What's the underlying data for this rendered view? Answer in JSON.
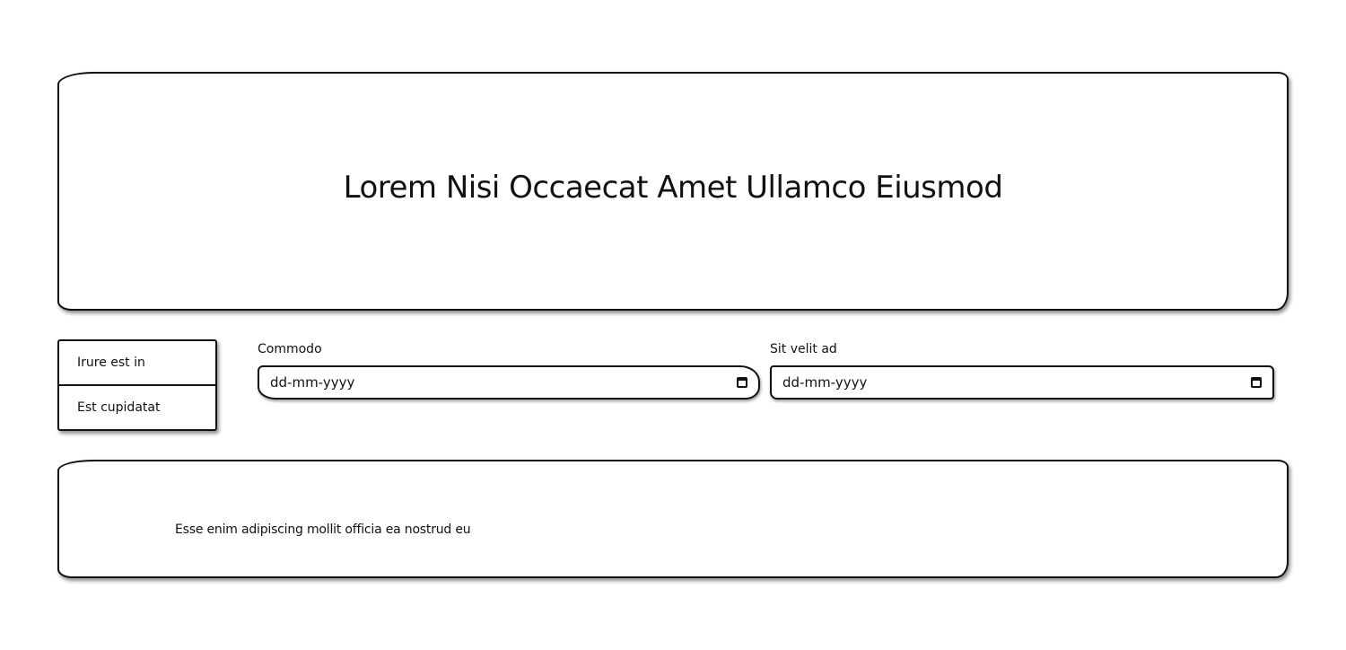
{
  "header": {
    "title": "Lorem Nisi Occaecat Amet Ullamco Eiusmod"
  },
  "menu": {
    "items": [
      {
        "label": "Irure est in"
      },
      {
        "label": "Est cupidatat"
      }
    ]
  },
  "form": {
    "fields": [
      {
        "label": "Commodo",
        "placeholder": "dd-mm-yyyy",
        "icon": "calendar-icon"
      },
      {
        "label": "Sit velit ad",
        "placeholder": "dd-mm-yyyy",
        "icon": "calendar-icon"
      }
    ]
  },
  "footer": {
    "text": "Esse enim adipiscing mollit officia ea nostrud eu"
  }
}
